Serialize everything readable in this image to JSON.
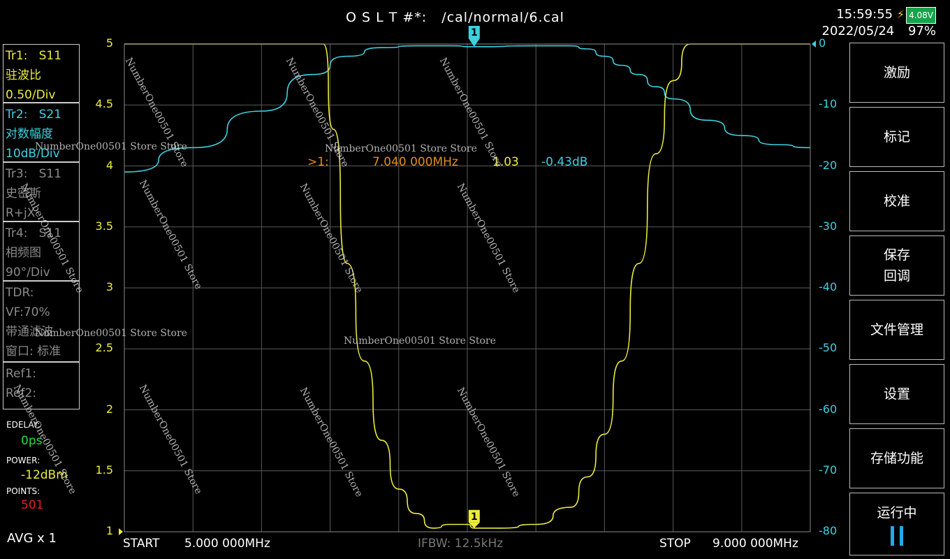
{
  "header": {
    "cal_title": "O S L T #*:   /cal/normal/6.cal",
    "time": "15:59:55",
    "date": "2022/05/24",
    "battery_voltage": "4.08V",
    "battery_percent": "97%"
  },
  "traces": [
    {
      "line1": "Tr1:   S11",
      "line2": "驻波比",
      "line3": "0.50/Div",
      "color": "#ecec3c"
    },
    {
      "line1": "Tr2:   S21",
      "line2": "对数幅度",
      "line3": "10dB/Div",
      "color": "#3fd0e0"
    },
    {
      "line1": "Tr3:   S11",
      "line2": "史密斯",
      "line3": "R+jX",
      "color": "#8a8a8a"
    },
    {
      "line1": "Tr4:   S11",
      "line2": "相频图",
      "line3": "90°/Div",
      "color": "#8a8a8a"
    },
    {
      "line1": "TDR:",
      "line2": "VF:70%",
      "line3": "带通滤波",
      "line4": "窗口: 标准",
      "color": "#8a8a8a"
    },
    {
      "line1": "Ref1:",
      "line2": "Ref2:",
      "color": "#8a8a8a"
    }
  ],
  "settings": {
    "edelay_label": "EDELAY:",
    "edelay_value": "0ps",
    "power_label": "POWER:",
    "power_value": "-12dBm",
    "points_label": "POINTS:",
    "points_value": "501",
    "avg": "AVG x 1"
  },
  "softkeys": [
    {
      "label": "激励"
    },
    {
      "label": "标记"
    },
    {
      "label": "校准"
    },
    {
      "label": "保存\n回调"
    },
    {
      "label": "文件管理"
    },
    {
      "label": "设置"
    },
    {
      "label": "存储功能"
    },
    {
      "label": "运行中"
    }
  ],
  "footer": {
    "start_label": "START",
    "start_value": "5.000 000MHz",
    "ifbw": "IFBW: 12.5kHz",
    "stop_label": "STOP",
    "stop_value": "9.000 000MHz"
  },
  "marker_readout": {
    "prefix": ">1:",
    "freq": "7.040 000MHz",
    "swr": "1.03",
    "db": "-0.43dB"
  },
  "marker_label": "1",
  "watermark_text": "NumberOne00501 Store Store",
  "watermark_text_rotated": "NumberOne00501  Store",
  "colors": {
    "s11_trace": "#ecec3c",
    "s21_trace": "#3fd0e0",
    "grid": "#5a5a5a",
    "marker_text": "#e08c20"
  },
  "chart_data": {
    "type": "line",
    "x_unit": "MHz",
    "xlim": [
      5.0,
      9.0
    ],
    "x_grid_divisions": 10,
    "left_axis": {
      "ylim": [
        1,
        5
      ],
      "ticks": [
        "5",
        "4.5",
        "4",
        "3.5",
        "3",
        "2.5",
        "2",
        "1.5",
        "1"
      ]
    },
    "right_axis": {
      "ylim": [
        -80,
        0
      ],
      "ticks": [
        "0",
        "-10",
        "-20",
        "-30",
        "-40",
        "-50",
        "-60",
        "-70",
        "-80"
      ]
    },
    "grid": true,
    "series": [
      {
        "name": "Tr1: S11",
        "axis": "left",
        "x": [
          5.0,
          6.0,
          6.16,
          6.22,
          6.3,
          6.4,
          6.5,
          6.6,
          6.7,
          6.8,
          6.9,
          7.0,
          7.04,
          7.2,
          7.4,
          7.6,
          7.7,
          7.8,
          7.9,
          8.0,
          8.1,
          8.2,
          8.3,
          8.4,
          8.45,
          8.5,
          9.0
        ],
        "values": [
          5.0,
          5.0,
          5.0,
          4.3,
          3.2,
          2.4,
          1.75,
          1.35,
          1.15,
          1.03,
          1.06,
          1.06,
          1.03,
          1.03,
          1.06,
          1.2,
          1.45,
          1.8,
          2.4,
          3.2,
          4.1,
          4.7,
          5.0,
          5.0,
          5.0,
          5.0,
          5.0
        ]
      },
      {
        "name": "Tr2: S21",
        "axis": "right",
        "x": [
          5.0,
          5.4,
          5.8,
          6.1,
          6.3,
          6.5,
          6.7,
          6.9,
          7.04,
          7.4,
          7.6,
          7.7,
          7.8,
          7.9,
          8.0,
          8.1,
          8.2,
          8.4,
          8.6,
          8.8,
          9.0
        ],
        "values": [
          -21,
          -17,
          -11,
          -5,
          -2,
          -0.6,
          -0.3,
          -0.3,
          -0.43,
          -0.3,
          -0.3,
          -0.8,
          -2,
          -3.5,
          -5,
          -7,
          -9,
          -12.5,
          -15,
          -16.5,
          -17
        ]
      }
    ],
    "markers": [
      {
        "label": "1",
        "x": 7.04,
        "swr": 1.03,
        "db": -0.43
      }
    ]
  }
}
